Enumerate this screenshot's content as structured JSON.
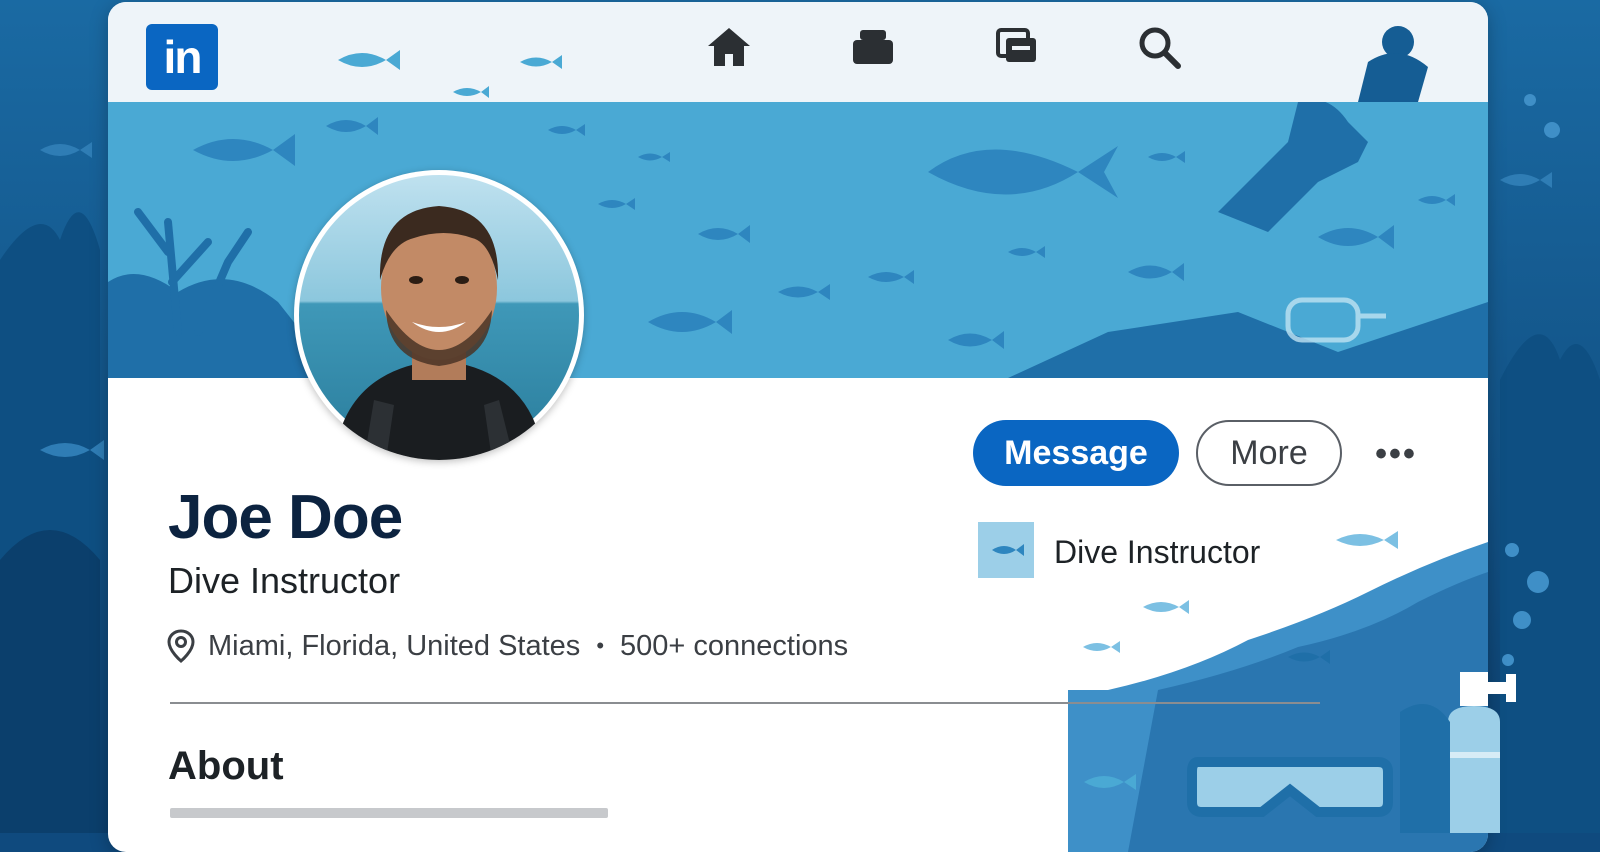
{
  "app": {
    "logo_text": "in"
  },
  "nav": {
    "icons": [
      "home-icon",
      "jobs-icon",
      "messaging-icon",
      "search-icon"
    ]
  },
  "profile": {
    "name": "Joe Doe",
    "headline": "Dive Instructor",
    "location": "Miami, Florida, United States",
    "connections": "500+ connections",
    "separator": "•",
    "current_position": "Dive Instructor"
  },
  "actions": {
    "message_label": "Message",
    "more_label": "More",
    "overflow_label": "•••"
  },
  "sections": {
    "about_title": "About"
  },
  "colors": {
    "brand": "#0a66c2",
    "banner": "#4aa9d4",
    "background": "#0f4a7e",
    "name": "#0c2340"
  }
}
